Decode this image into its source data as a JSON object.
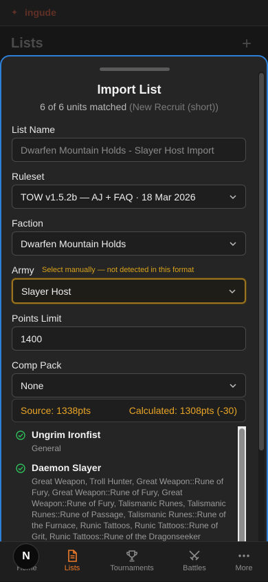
{
  "app": {
    "brand": "ingude",
    "page_title": "Lists",
    "add_icon": "plus-icon"
  },
  "sheet": {
    "title": "Import List",
    "subtitle_main": "6 of 6 units matched",
    "subtitle_muted": "(New Recruit (short))"
  },
  "form": {
    "list_name_label": "List Name",
    "list_name_placeholder": "Dwarfen Mountain Holds - Slayer Host Import",
    "ruleset_label": "Ruleset",
    "ruleset_value": "TOW v1.5.2b — AJ + FAQ · 18 Mar 2026",
    "faction_label": "Faction",
    "faction_value": "Dwarfen Mountain Holds",
    "army_label": "Army",
    "army_note": "Select manually — not detected in this format",
    "army_value": "Slayer Host",
    "points_label": "Points Limit",
    "points_value": "1400",
    "comp_label": "Comp Pack",
    "comp_value": "None"
  },
  "summary": {
    "source": "Source: 1338pts",
    "calculated": "Calculated: 1308pts (-30)"
  },
  "units": [
    {
      "name": "Ungrim Ironfist",
      "detail": "General"
    },
    {
      "name": "Daemon Slayer",
      "detail": "Great Weapon, Troll Hunter, Great Weapon::Rune of Fury, Great Weapon::Rune of Fury, Great Weapon::Rune of Fury, Talismanic Runes, Talismanic Runes::Rune of Passage, Talismanic Runes::Rune of the Furnace, Runic Tattoos, Runic Tattoos::Rune of Grit, Runic Tattoos::Rune of the Dragonseeker"
    }
  ],
  "tabs": [
    {
      "label": "Home",
      "icon": "next-logo-icon"
    },
    {
      "label": "Lists",
      "icon": "document-icon"
    },
    {
      "label": "Tournaments",
      "icon": "trophy-icon"
    },
    {
      "label": "Battles",
      "icon": "crossed-swords-icon"
    },
    {
      "label": "More",
      "icon": "ellipsis-icon"
    }
  ],
  "colors": {
    "accent": "#f07b2a",
    "warning": "#d9a21b",
    "success": "#2fbf5a",
    "sheet_border": "#2f80d8"
  }
}
